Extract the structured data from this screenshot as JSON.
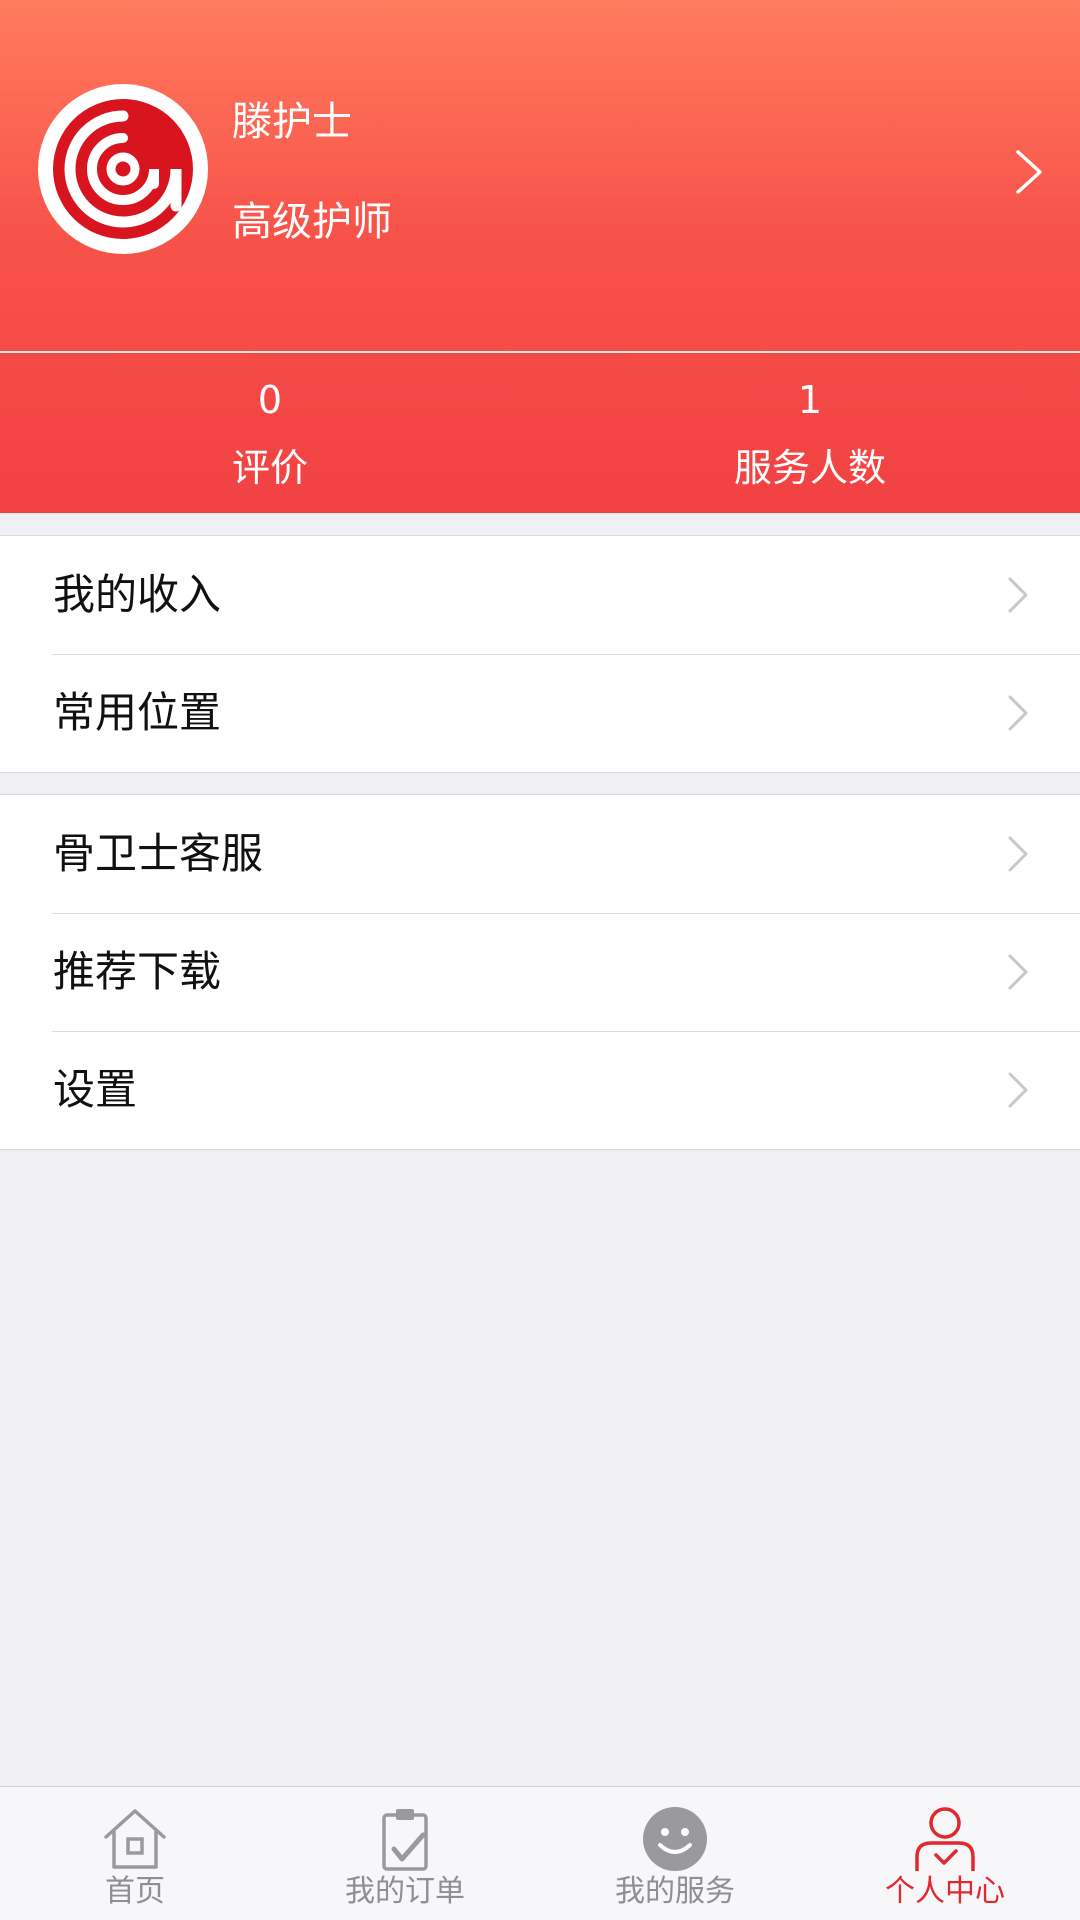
{
  "profile": {
    "name": "滕护士",
    "title": "高级护师"
  },
  "stats": [
    {
      "value": "0",
      "label": "评价"
    },
    {
      "value": "1",
      "label": "服务人数"
    }
  ],
  "menu_groups": [
    {
      "items": [
        {
          "label": "我的收入"
        },
        {
          "label": "常用位置"
        }
      ]
    },
    {
      "items": [
        {
          "label": "骨卫士客服"
        },
        {
          "label": "推荐下载"
        },
        {
          "label": "设置"
        }
      ]
    }
  ],
  "tabbar": {
    "active_index": 3,
    "tabs": [
      {
        "label": "首页",
        "icon": "home-icon"
      },
      {
        "label": "我的订单",
        "icon": "clipboard-icon"
      },
      {
        "label": "我的服务",
        "icon": "smiley-icon"
      },
      {
        "label": "个人中心",
        "icon": "profile-icon"
      }
    ]
  },
  "colors": {
    "header_top": "#ff7b5e",
    "header_bottom": "#f24143",
    "accent": "#e0282f",
    "inactive": "#8e8e93",
    "background": "#efeff4"
  }
}
